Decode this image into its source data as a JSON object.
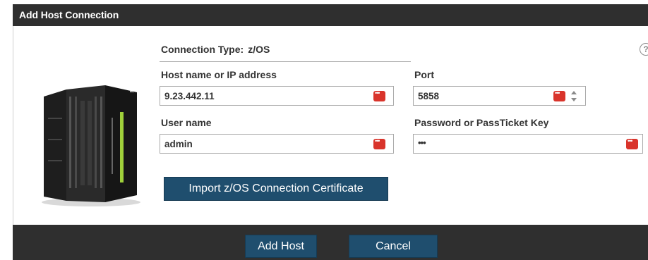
{
  "dialog": {
    "title": "Add Host Connection"
  },
  "connection": {
    "label": "Connection Type:",
    "value": "z/OS"
  },
  "host": {
    "label": "Host name or IP address",
    "value": "9.23.442.11"
  },
  "port": {
    "label": "Port",
    "value": "5858"
  },
  "user": {
    "label": "User name",
    "value": "admin"
  },
  "password": {
    "label": "Password or PassTicket Key",
    "masked_value": "•••"
  },
  "help": {
    "glyph": "?"
  },
  "actions": {
    "import_label": "Import z/OS Connection Certificate",
    "add_label": "Add Host",
    "cancel_label": "Cancel"
  },
  "icons": {
    "help": "help-icon",
    "password_manager": "password-manager-icon",
    "spinner": "spinner-arrows-icon",
    "mainframe": "mainframe-server-icon"
  },
  "colors": {
    "title_bar": "#2f2f2f",
    "button_bg": "#1f4e6e",
    "badge": "#d9342b"
  }
}
